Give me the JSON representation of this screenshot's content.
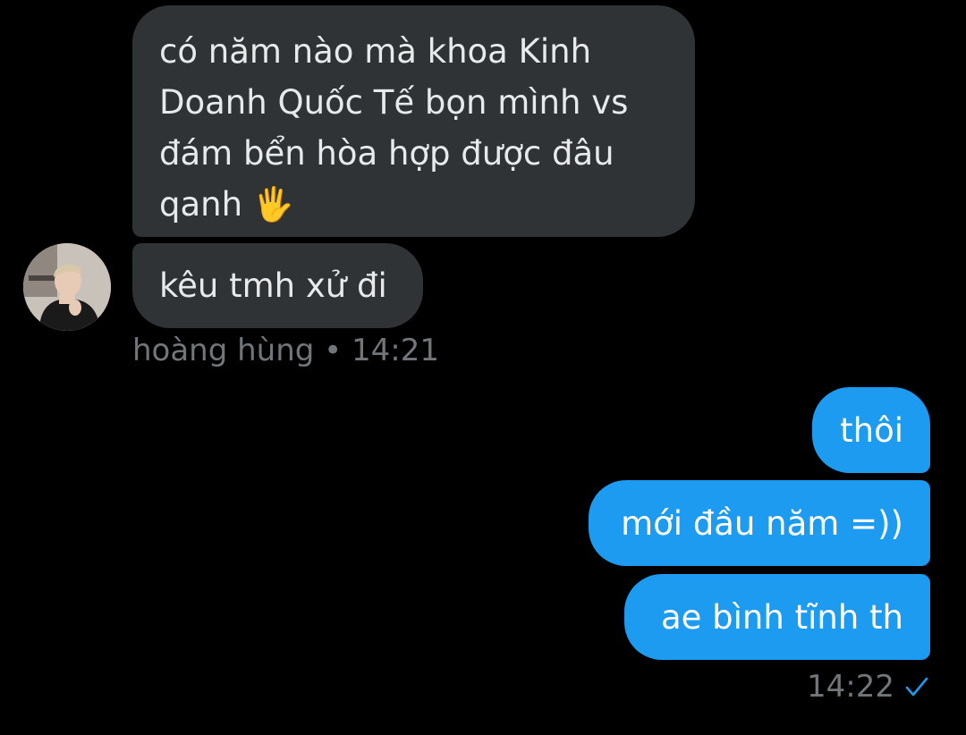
{
  "messages_in": [
    {
      "lines": [
        "có năm nào mà khoa Kinh",
        "Doanh Quốc Tế bọn mình vs",
        "đám bển hòa hợp được đâu",
        "qanh 🖐"
      ]
    },
    {
      "text": "kêu tmh xử đi"
    }
  ],
  "sender": {
    "name": "hoàng hùng",
    "time": "14:21",
    "separator": "•"
  },
  "messages_out": [
    {
      "text": "thôi"
    },
    {
      "text": "mới đầu năm =))"
    },
    {
      "text": "ae bình tĩnh th"
    }
  ],
  "outgoing_meta": {
    "time": "14:22",
    "status_icon": "single-check-icon"
  },
  "colors": {
    "background": "#000000",
    "incoming_bubble": "#2f3336",
    "outgoing_bubble": "#1d9bf0",
    "meta_text": "#71767b",
    "check": "#1d9bf0"
  }
}
